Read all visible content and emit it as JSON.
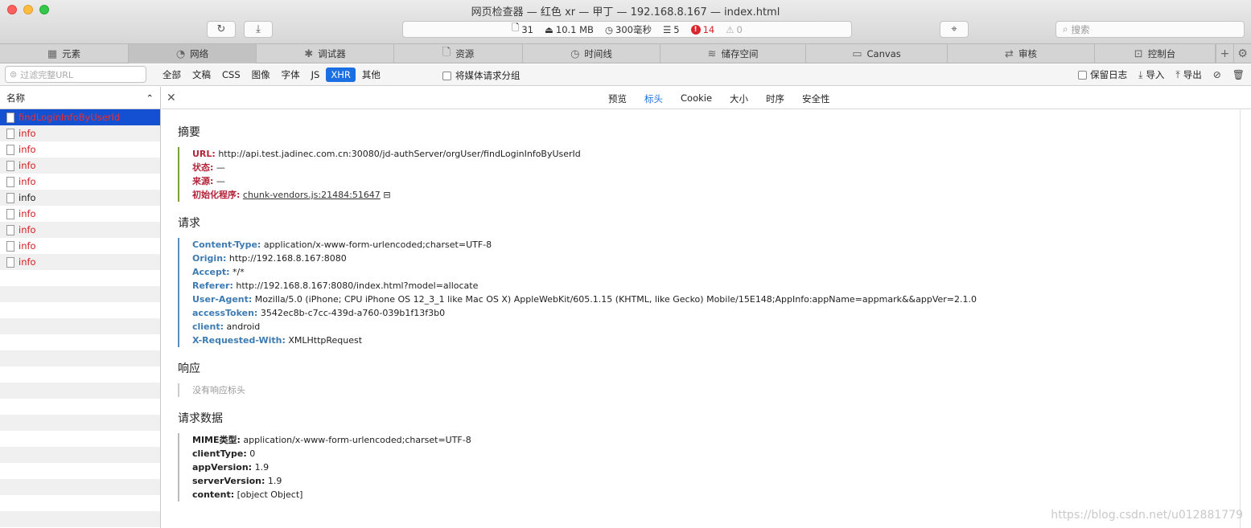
{
  "window": {
    "title": "网页检查器 — 红色 xr — 甲丁 — 192.168.8.167 — index.html"
  },
  "status": {
    "resources": "31",
    "size": "10.1 MB",
    "time": "300毫秒",
    "logs": "5",
    "errors": "14",
    "warnings": "0"
  },
  "search": {
    "placeholder": "搜索"
  },
  "tabs": [
    {
      "label": "元素",
      "icon": "layout-icon"
    },
    {
      "label": "网络",
      "icon": "network-icon"
    },
    {
      "label": "调试器",
      "icon": "bug-icon"
    },
    {
      "label": "资源",
      "icon": "file-icon"
    },
    {
      "label": "时间线",
      "icon": "clock-icon"
    },
    {
      "label": "储存空间",
      "icon": "database-icon"
    },
    {
      "label": "Canvas",
      "icon": "image-icon"
    },
    {
      "label": "审核",
      "icon": "audit-icon"
    },
    {
      "label": "控制台",
      "icon": "console-icon"
    }
  ],
  "filter": {
    "placeholder": "过滤完整URL",
    "types": [
      "全部",
      "文稿",
      "CSS",
      "图像",
      "字体",
      "JS",
      "XHR",
      "其他"
    ],
    "selected_type": "XHR",
    "group_media_label": "将媒体请求分组",
    "preserve_log_label": "保留日志",
    "import_label": "导入",
    "export_label": "导出"
  },
  "list": {
    "header": "名称",
    "rows": [
      {
        "name": "findLoginInfoByUserId",
        "selected": true,
        "error": true
      },
      {
        "name": "info",
        "error": true
      },
      {
        "name": "info",
        "error": true
      },
      {
        "name": "info",
        "error": true
      },
      {
        "name": "info",
        "error": true
      },
      {
        "name": "info",
        "error": false
      },
      {
        "name": "info",
        "error": true
      },
      {
        "name": "info",
        "error": true
      },
      {
        "name": "info",
        "error": true
      },
      {
        "name": "info",
        "error": true
      }
    ]
  },
  "detail": {
    "tabs": [
      "预览",
      "标头",
      "Cookie",
      "大小",
      "时序",
      "安全性"
    ],
    "selected_tab": "标头",
    "summary": {
      "title": "摘要",
      "url_key": "URL:",
      "url": "http://api.test.jadinec.com.cn:30080/jd-authServer/orgUser/findLoginInfoByUserId",
      "status_key": "状态:",
      "status": "—",
      "source_key": "来源:",
      "source": "—",
      "initiator_key": "初始化程序:",
      "initiator": "chunk-vendors.js:21484:51647"
    },
    "request": {
      "title": "请求",
      "headers": [
        {
          "k": "Content-Type:",
          "v": "application/x-www-form-urlencoded;charset=UTF-8"
        },
        {
          "k": "Origin:",
          "v": "http://192.168.8.167:8080"
        },
        {
          "k": "Accept:",
          "v": "*/*"
        },
        {
          "k": "Referer:",
          "v": "http://192.168.8.167:8080/index.html?model=allocate"
        },
        {
          "k": "User-Agent:",
          "v": "Mozilla/5.0 (iPhone; CPU iPhone OS 12_3_1 like Mac OS X) AppleWebKit/605.1.15 (KHTML, like Gecko) Mobile/15E148;AppInfo:appName=appmark&&appVer=2.1.0"
        },
        {
          "k": "accessToken:",
          "v": "3542ec8b-c7cc-439d-a760-039b1f13f3b0"
        },
        {
          "k": "client:",
          "v": "android"
        },
        {
          "k": "X-Requested-With:",
          "v": "XMLHttpRequest"
        }
      ]
    },
    "response": {
      "title": "响应",
      "empty": "没有响应标头"
    },
    "request_data": {
      "title": "请求数据",
      "items": [
        {
          "k": "MIME类型:",
          "v": "application/x-www-form-urlencoded;charset=UTF-8"
        },
        {
          "k": "clientType:",
          "v": "0"
        },
        {
          "k": "appVersion:",
          "v": "1.9"
        },
        {
          "k": "serverVersion:",
          "v": "1.9"
        },
        {
          "k": "content:",
          "v": "[object Object]"
        }
      ]
    }
  },
  "watermark": "https://blog.csdn.net/u012881779"
}
